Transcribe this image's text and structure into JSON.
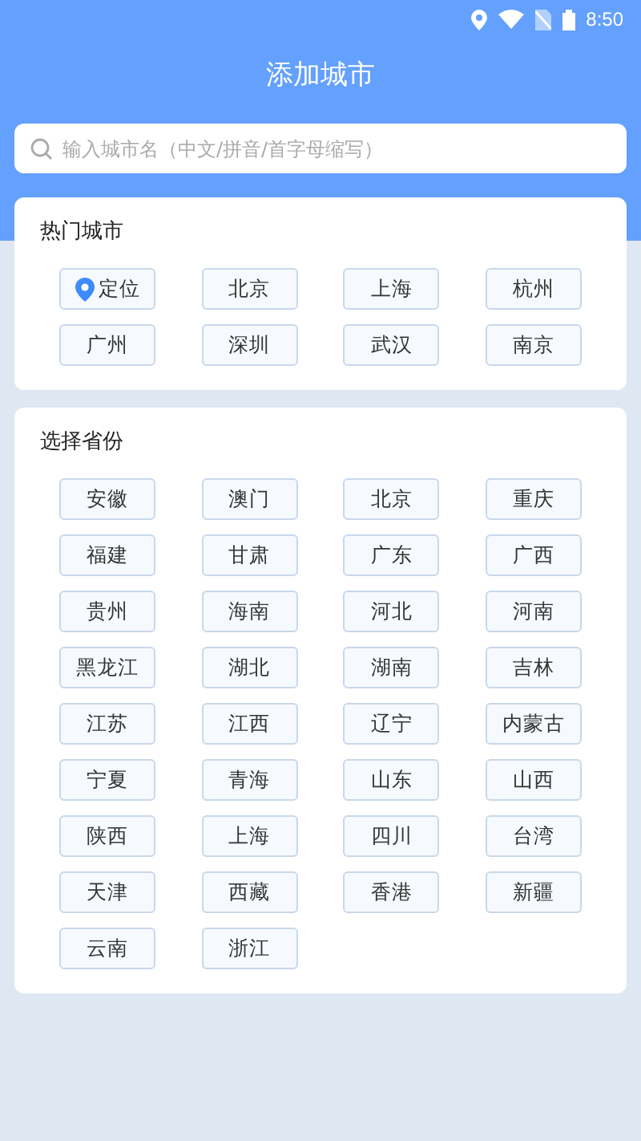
{
  "status_bar": {
    "time": "8:50"
  },
  "title": "添加城市",
  "search": {
    "placeholder": "输入城市名（中文/拼音/首字母缩写）"
  },
  "hot": {
    "heading": "热门城市",
    "cities": [
      {
        "label": "定位",
        "kind": "locate"
      },
      {
        "label": "北京",
        "kind": "city"
      },
      {
        "label": "上海",
        "kind": "city"
      },
      {
        "label": "杭州",
        "kind": "city"
      },
      {
        "label": "广州",
        "kind": "city"
      },
      {
        "label": "深圳",
        "kind": "city"
      },
      {
        "label": "武汉",
        "kind": "city"
      },
      {
        "label": "南京",
        "kind": "city"
      }
    ]
  },
  "provinces": {
    "heading": "选择省份",
    "items": [
      "安徽",
      "澳门",
      "北京",
      "重庆",
      "福建",
      "甘肃",
      "广东",
      "广西",
      "贵州",
      "海南",
      "河北",
      "河南",
      "黑龙江",
      "湖北",
      "湖南",
      "吉林",
      "江苏",
      "江西",
      "辽宁",
      "内蒙古",
      "宁夏",
      "青海",
      "山东",
      "山西",
      "陕西",
      "上海",
      "四川",
      "台湾",
      "天津",
      "西藏",
      "香港",
      "新疆",
      "云南",
      "浙江"
    ]
  }
}
